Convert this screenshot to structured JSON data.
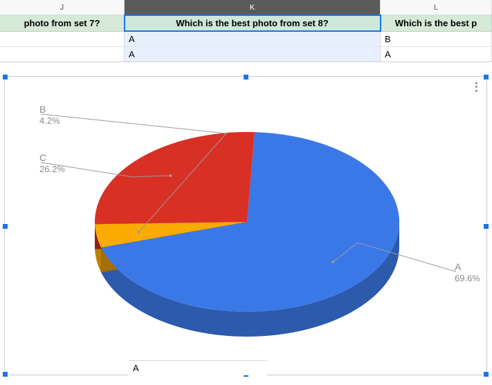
{
  "columns": {
    "J": {
      "letter": "J",
      "header": "photo from set 7?"
    },
    "K": {
      "letter": "K",
      "header": "Which is the best photo from set 8?"
    },
    "L": {
      "letter": "L",
      "header": "Which is the best p"
    }
  },
  "rows": [
    {
      "J": "",
      "K": "A",
      "L": "B"
    },
    {
      "J": "",
      "K": "A",
      "L": "A"
    }
  ],
  "peek_row": {
    "K": "A"
  },
  "chart_data": {
    "type": "pie",
    "style": "3d",
    "series": [
      {
        "name": "A",
        "value": 69.6,
        "label": "69.6%",
        "color": "#3b78e7"
      },
      {
        "name": "B",
        "value": 4.2,
        "label": "4.2%",
        "color": "#f9ab00"
      },
      {
        "name": "C",
        "value": 26.2,
        "label": "26.2%",
        "color": "#d93025"
      }
    ]
  }
}
